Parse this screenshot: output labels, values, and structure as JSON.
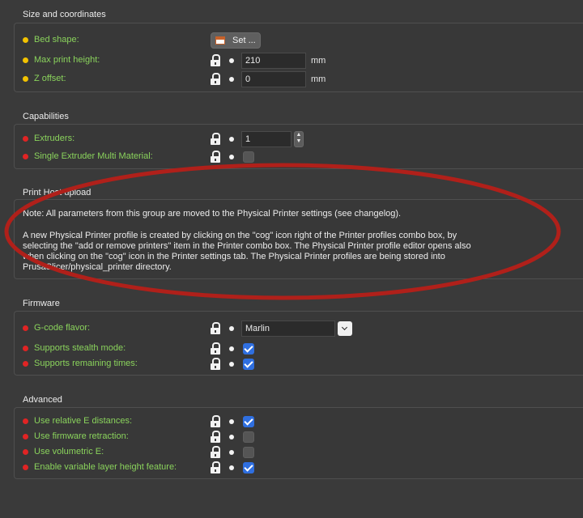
{
  "groups": {
    "size": {
      "title": "Size and coordinates",
      "bed_shape_label": "Bed shape:",
      "bed_shape_button": "Set ...",
      "max_height_label": "Max print height:",
      "max_height_value": "210",
      "max_height_unit": "mm",
      "z_offset_label": "Z offset:",
      "z_offset_value": "0",
      "z_offset_unit": "mm"
    },
    "capabilities": {
      "title": "Capabilities",
      "extruders_label": "Extruders:",
      "extruders_value": "1",
      "semm_label": "Single Extruder Multi Material:",
      "semm_checked": false
    },
    "print_host": {
      "title": "Print Host upload",
      "note_line1": "Note: All parameters from this group are moved to the Physical Printer settings (see changelog).",
      "note_line2": "A new Physical Printer profile is created by clicking on the \"cog\" icon right of the Printer profiles combo box, by",
      "note_line3": "selecting the \"add or remove printers\" item in the Printer combo box. The Physical Printer profile editor opens also",
      "note_line4": "when clicking on the \"cog\" icon in the Printer settings tab. The Physical Printer profiles are being stored into",
      "note_line5": "PrusaSlicer/physical_printer directory."
    },
    "firmware": {
      "title": "Firmware",
      "gcode_flavor_label": "G-code flavor:",
      "gcode_flavor_value": "Marlin",
      "stealth_label": "Supports stealth mode:",
      "stealth_checked": true,
      "remaining_label": "Supports remaining times:",
      "remaining_checked": true
    },
    "advanced": {
      "title": "Advanced",
      "relative_e_label": "Use relative E distances:",
      "relative_e_checked": true,
      "fw_retraction_label": "Use firmware retraction:",
      "fw_retraction_checked": false,
      "volumetric_label": "Use volumetric E:",
      "volumetric_checked": false,
      "variable_layer_label": "Enable variable layer height feature:",
      "variable_layer_checked": true
    }
  },
  "colors": {
    "label_green": "#8ad35c",
    "dot_yellow": "#f2c200",
    "dot_red": "#e02424",
    "checkbox_blue": "#2f6fe0",
    "annotation_oval": "#b0201a"
  }
}
